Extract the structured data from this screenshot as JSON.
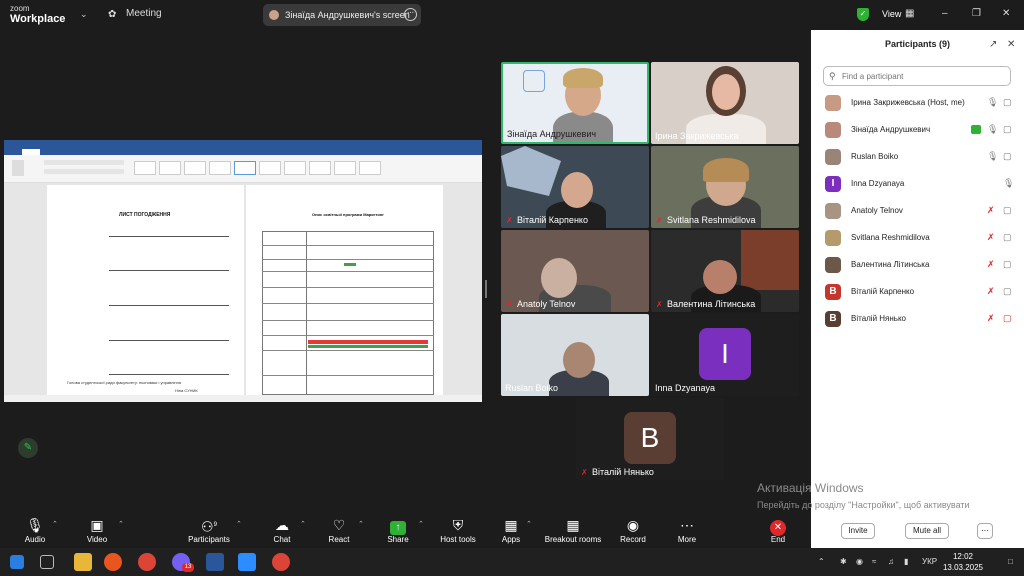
{
  "topbar": {
    "brand_line1": "zoom",
    "brand_line2": "Workplace",
    "meeting_label": "Meeting",
    "screen_share_label": "Зінаїда Андрушкевич's screen",
    "view_label": "View"
  },
  "shared_screen": {
    "doc_title": "ЛИСТ ПОГОДЖЕННЯ",
    "right_title": "Опис освітньої програми Маркетинг",
    "left_bottom_text": "Голова студентської ради факультету: економіки і управління",
    "signature_name": "Ніна СУНИК"
  },
  "videos": [
    {
      "name": "Зінаїда Андрушкевич",
      "muted": false
    },
    {
      "name": "Ірина Закрижевська",
      "muted": false
    },
    {
      "name": "Віталій Карпенко",
      "muted": true
    },
    {
      "name": "Svitlana Reshmidilova",
      "muted": true
    },
    {
      "name": "Anatoly Telnov",
      "muted": true
    },
    {
      "name": "Валентина Літинська",
      "muted": true
    },
    {
      "name": "Ruslan Boiko",
      "muted": false
    },
    {
      "name": "Inna Dzyanaya",
      "muted": false,
      "initial": "I"
    },
    {
      "name": "Віталій Нянько",
      "muted": true,
      "initial": "B"
    }
  ],
  "panel": {
    "title": "Participants (9)",
    "search_placeholder": "Find a participant",
    "participants": [
      {
        "name": "Ірина Закрижевська (Host, me)",
        "avatar_color": "#c79a84"
      },
      {
        "name": "Зінаїда Андрушкевич",
        "avatar_color": "#b98a7a"
      },
      {
        "name": "Ruslan Boiko",
        "avatar_color": "#9a8478"
      },
      {
        "name": "Inna Dzyanaya",
        "avatar_color": "#7b2fbe",
        "initial": "I"
      },
      {
        "name": "Anatoly Telnov",
        "avatar_color": "#a89482"
      },
      {
        "name": "Svitlana Reshmidilova",
        "avatar_color": "#b59a6c"
      },
      {
        "name": "Валентина Літинська",
        "avatar_color": "#6b5848"
      },
      {
        "name": "Віталій Карпенко",
        "avatar_color": "#c4372e",
        "initial": "B"
      },
      {
        "name": "Віталій Нянько",
        "avatar_color": "#5a3d33",
        "initial": "B"
      }
    ],
    "invite_label": "Invite",
    "mute_all_label": "Mute all"
  },
  "toolbar": {
    "audio": "Audio",
    "video": "Video",
    "participants": "Participants",
    "participants_count": "9",
    "chat": "Chat",
    "react": "React",
    "share": "Share",
    "host_tools": "Host tools",
    "apps": "Apps",
    "breakout_rooms": "Breakout rooms",
    "record": "Record",
    "more": "More",
    "end": "End"
  },
  "watermark": {
    "line1": "Активація Windows",
    "line2": "Перейдіть до розділу \"Настройки\", щоб активувати Windows."
  },
  "taskbar": {
    "language": "УКР",
    "time": "12:02",
    "date": "13.03.2025",
    "viber_badge": "13"
  },
  "colors": {
    "accent_green": "#35c04a",
    "end_red": "#e02828",
    "share_green": "#2eb135"
  }
}
